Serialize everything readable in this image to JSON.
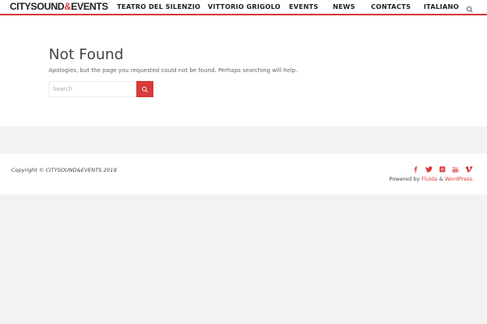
{
  "header": {
    "logo_main": "CITYSOUND",
    "logo_amp": "&",
    "logo_tail": "EVENTS",
    "nav": [
      {
        "label": "TEATRO DEL SILENZIO"
      },
      {
        "label": "VITTORIO GRIGOLO"
      },
      {
        "label": "EVENTS"
      },
      {
        "label": "NEWS"
      },
      {
        "label": "CONTACTS"
      },
      {
        "label": "ITALIANO"
      }
    ]
  },
  "main": {
    "title": "Not Found",
    "message": "Apologies, but the page you requested could not be found. Perhaps searching will help.",
    "search_placeholder": "Search"
  },
  "footer": {
    "copyright": "Copyright © CITYSOUND&EVENTS 2018",
    "powered_prefix": "Powered by",
    "powered_link1": "Fluida",
    "powered_sep": "&",
    "powered_link2": "WordPress.",
    "social_icons": [
      "facebook-icon",
      "twitter-icon",
      "instagram-icon",
      "youtube-icon",
      "vimeo-icon"
    ]
  },
  "colors": {
    "accent": "#d63a3a",
    "text": "#444444",
    "background": "#f2f2f2"
  }
}
